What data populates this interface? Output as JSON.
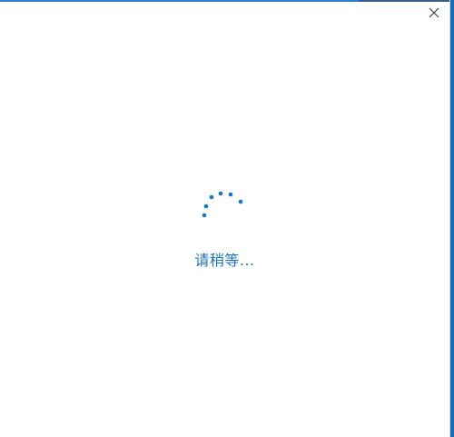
{
  "dialog": {
    "loading_text": "请稍等...",
    "accent_color": "#0a78d4",
    "close_icon": "close-icon",
    "spinner_icon": "loading-spinner-icon"
  }
}
